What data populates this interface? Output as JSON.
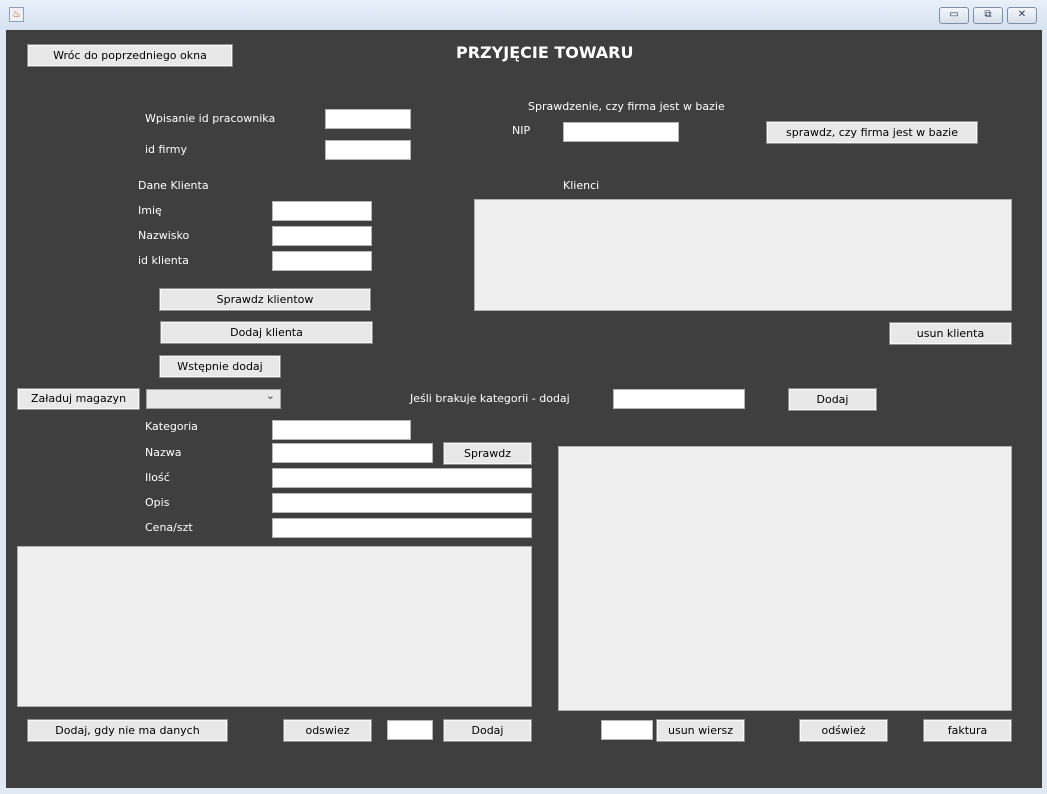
{
  "window": {
    "app_icon": "java-icon",
    "controls": {
      "minimize": "▭",
      "maximize": "⧉",
      "close": "✕"
    }
  },
  "header": {
    "back_button": "Wróc do poprzedniego okna",
    "title": "PRZYJĘCIE TOWARU"
  },
  "employee": {
    "employee_id_label": "Wpisanie id pracownika",
    "employee_id_value": "",
    "company_id_label": "id firmy",
    "company_id_value": ""
  },
  "company_check": {
    "heading": "Sprawdzenie, czy firma jest w bazie",
    "nip_label": "NIP",
    "nip_value": "",
    "check_button": "sprawdz, czy firma jest w bazie"
  },
  "client": {
    "heading": "Dane Klienta",
    "first_name_label": "Imię",
    "last_name_label": "Nazwisko",
    "client_id_label": "id klienta",
    "check_clients_button": "Sprawdz klientow",
    "add_client_button": "Dodaj klienta",
    "pre_add_button": "Wstępnie dodaj"
  },
  "clients_panel": {
    "heading": "Klienci",
    "remove_client_button": "usun klienta"
  },
  "warehouse": {
    "load_button": "Załaduj magazyn",
    "combo_value": "",
    "missing_category_label": "Jeśli brakuje kategorii - dodaj",
    "add_category_button": "Dodaj"
  },
  "product": {
    "category_label": "Kategoria",
    "name_label": "Nazwa",
    "check_button": "Sprawdz",
    "quantity_label": "Ilość",
    "description_label": "Opis",
    "price_label": "Cena/szt"
  },
  "bottom": {
    "add_no_data_button": "Dodaj, gdy nie ma danych",
    "refresh_button": "odswiez",
    "add_button": "Dodaj",
    "delete_row_button": "usun wiersz",
    "refresh2_button": "odśwież",
    "invoice_button": "faktura"
  }
}
